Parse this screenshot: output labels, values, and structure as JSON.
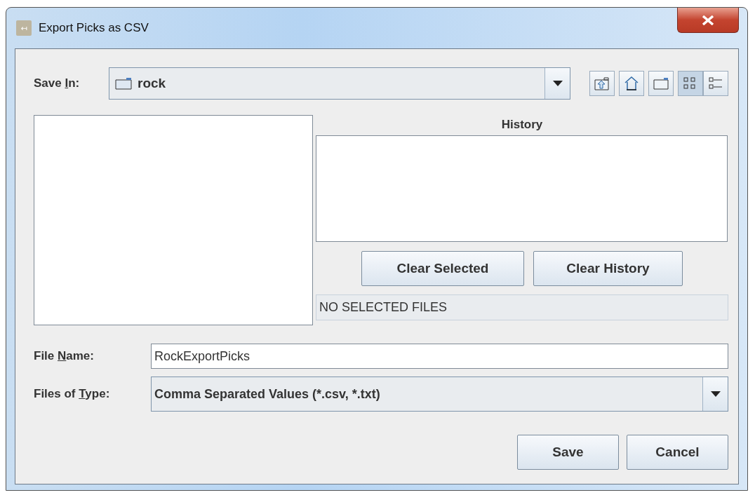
{
  "window": {
    "title": "Export Picks as CSV",
    "app_icon": "↤"
  },
  "save_in": {
    "label": [
      "Save ",
      "I",
      "n:"
    ],
    "value": "rock"
  },
  "toolbar": [
    {
      "kind": "up",
      "selected": false
    },
    {
      "kind": "home",
      "selected": false
    },
    {
      "kind": "new-folder",
      "selected": false
    },
    {
      "kind": "list",
      "selected": true
    },
    {
      "kind": "details",
      "selected": false
    }
  ],
  "history": {
    "title": "History",
    "buttons": [
      "Clear Selected",
      "Clear History"
    ],
    "status": "NO SELECTED FILES"
  },
  "file_name": {
    "label": [
      "File ",
      "N",
      "ame:"
    ],
    "value": "RockExportPicks"
  },
  "file_type": {
    "label": [
      "Files of ",
      "T",
      "ype:"
    ],
    "value": "Comma Separated Values (*.csv, *.txt)"
  },
  "buttons": [
    "Save",
    "Cancel"
  ]
}
